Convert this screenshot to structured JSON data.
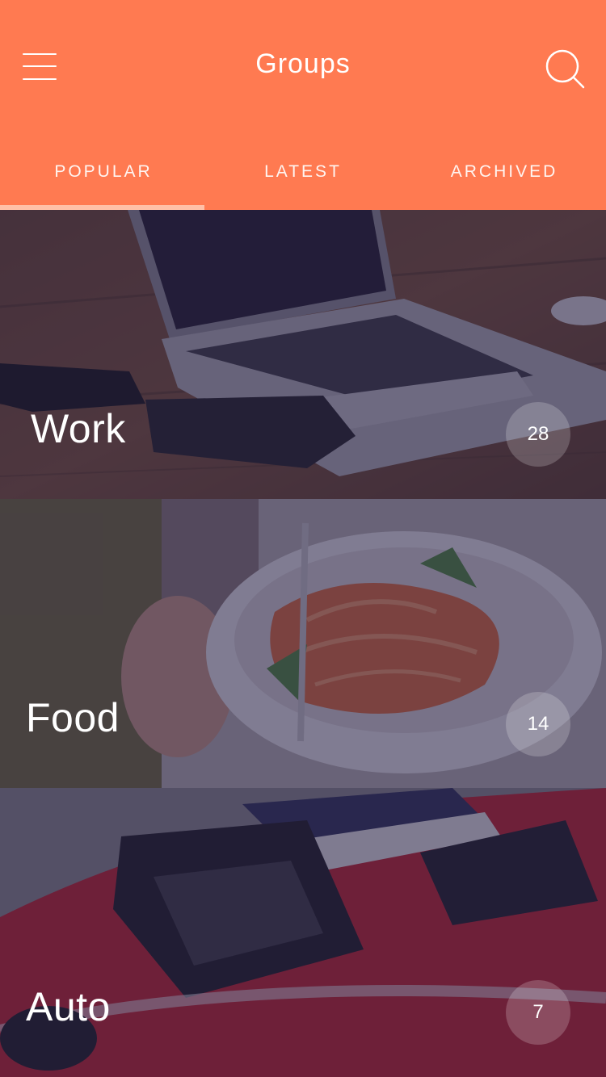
{
  "header": {
    "title": "Groups",
    "menu_icon": "hamburger-menu-icon",
    "search_icon": "search-icon",
    "background_color": "#ff7a51"
  },
  "tabs": [
    {
      "label": "POPULAR",
      "active": true
    },
    {
      "label": "LATEST",
      "active": false
    },
    {
      "label": "ARCHIVED",
      "active": false
    }
  ],
  "groups": [
    {
      "name": "Work",
      "count": "28",
      "image": "laptop-on-desk"
    },
    {
      "name": "Food",
      "count": "14",
      "image": "salad-bowl"
    },
    {
      "name": "Auto",
      "count": "7",
      "image": "red-sports-car"
    }
  ]
}
